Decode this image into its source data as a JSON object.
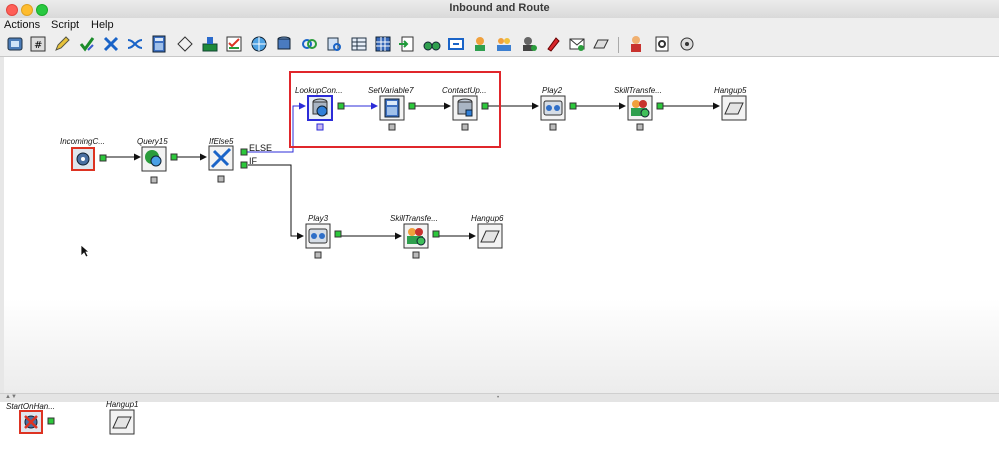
{
  "window": {
    "title": "Inbound and Route"
  },
  "menu": [
    "Actions",
    "Script",
    "Help"
  ],
  "toolbar_icons": [
    "script-editor-icon",
    "variable-icon",
    "pencil-icon",
    "check-icon",
    "tools-icon",
    "shuffle-icon",
    "calculator-icon",
    "diamond-icon",
    "switch-icon",
    "checklist-icon",
    "globe-icon",
    "database-icon",
    "link-icon",
    "query-icon",
    "table-icon",
    "import-icon",
    "binoculars-icon",
    "monitor-icon",
    "agent-icon",
    "group-icon",
    "user-icon",
    "edit-icon",
    "mail-icon",
    "phone-icon",
    "agent-red-icon",
    "settings-icon",
    "settings2-icon"
  ],
  "nodes": {
    "incoming": "IncomingC...",
    "query": "Query15",
    "ifelse": "IfElse5",
    "lookup": "LookupCon...",
    "setvar": "SetVariable7",
    "contactup": "ContactUp...",
    "play2": "Play2",
    "skill1": "SkillTransfe...",
    "hangup5": "Hangup5",
    "play3": "Play3",
    "skill2": "SkillTransfe...",
    "hangup6": "Hangup6",
    "starton": "StartOnHan...",
    "hangup1": "Hangup1"
  },
  "branches": {
    "else": "ELSE",
    "if": "IF"
  },
  "colors": {
    "highlight": "#e0262b",
    "selected_wire": "#2c2cd8"
  }
}
